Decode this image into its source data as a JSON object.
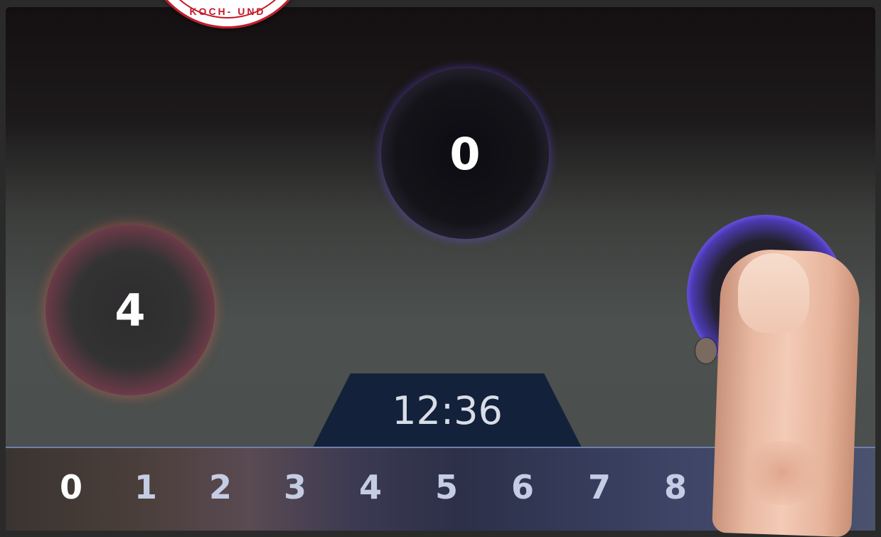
{
  "stamp": {
    "text": "KOCH- UND"
  },
  "cooking_zones": [
    {
      "level": "0",
      "ring_color": "#7658ff"
    },
    {
      "level": "4",
      "ring_color": "#ff7c4a"
    },
    {
      "level": "",
      "ring_color": "#7a5cff"
    }
  ],
  "timer": {
    "time": "12:36"
  },
  "power_levels": {
    "items": [
      "0",
      "1",
      "2",
      "3",
      "4",
      "5",
      "6",
      "7",
      "8"
    ],
    "selected": "0"
  }
}
